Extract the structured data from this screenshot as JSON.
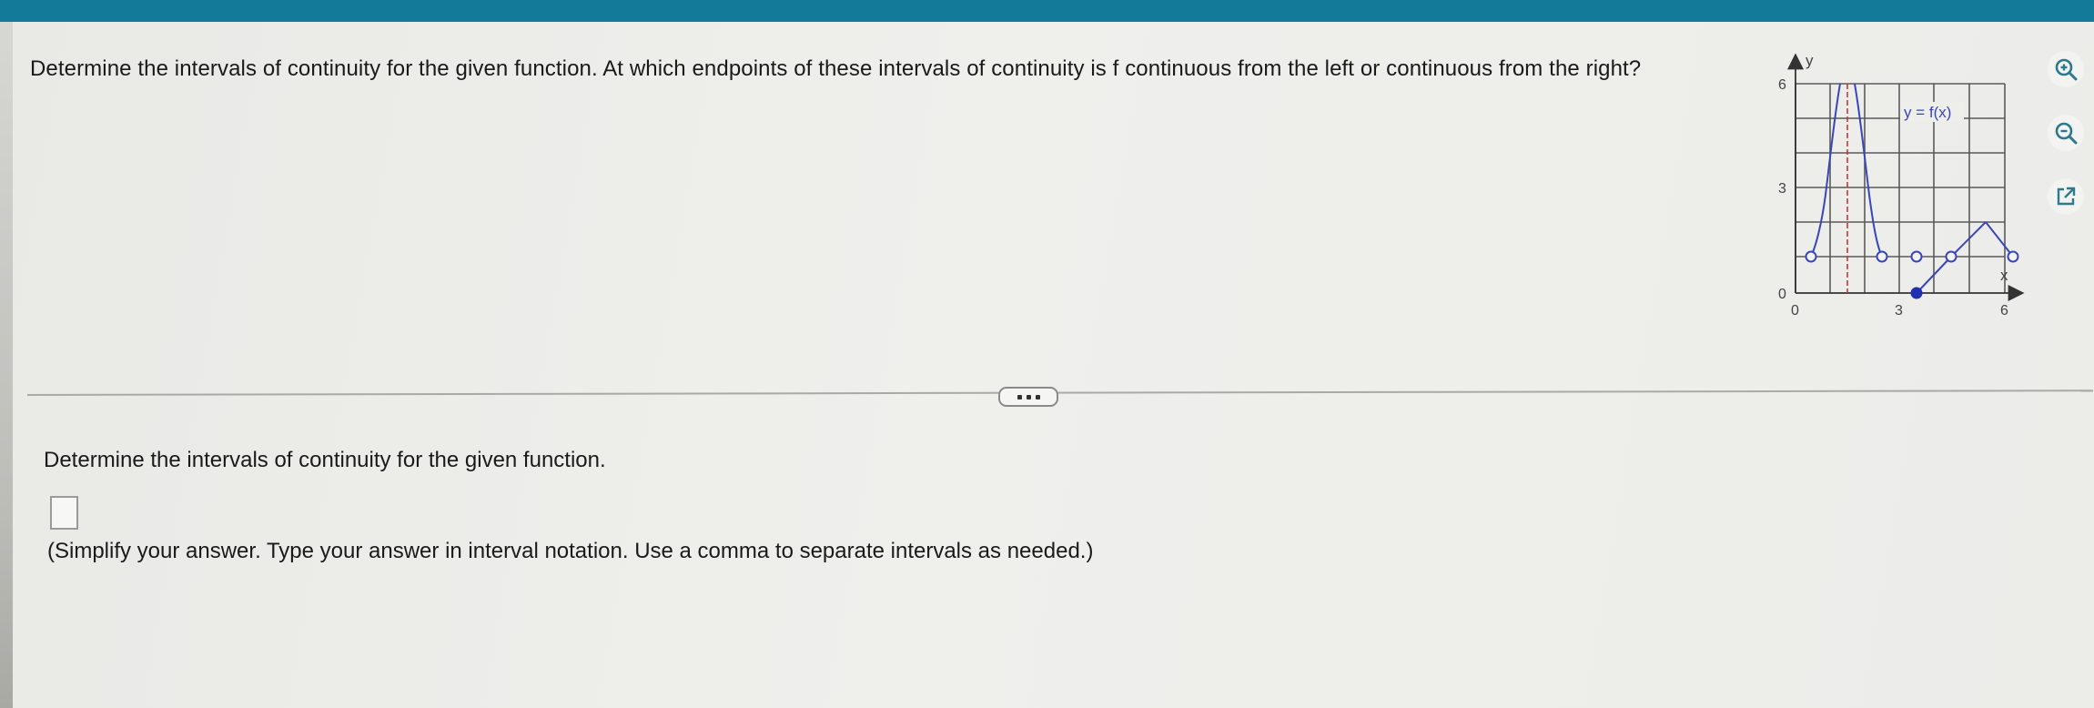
{
  "question": {
    "text": "Determine the intervals of continuity for the given function. At which endpoints of these intervals of continuity is f continuous from the left or continuous from the right?"
  },
  "graph": {
    "y_axis_label": "y",
    "x_axis_label": "x",
    "function_label": "y = f(x)",
    "y_ticks": [
      "6",
      "3",
      "0"
    ],
    "x_ticks": [
      "0",
      "3",
      "6"
    ],
    "colors": {
      "curve": "#3a46b8",
      "asymptote": "#c23a3a",
      "grid": "#5a5a5a"
    }
  },
  "tools": {
    "zoom_in": "zoom-in-icon",
    "zoom_out": "zoom-out-icon",
    "popout": "external-link-icon"
  },
  "part": {
    "prompt": "Determine the intervals of continuity for the given function.",
    "answer_value": "",
    "hint": "(Simplify your answer. Type your answer in interval notation. Use a comma to separate intervals as needed.)"
  }
}
